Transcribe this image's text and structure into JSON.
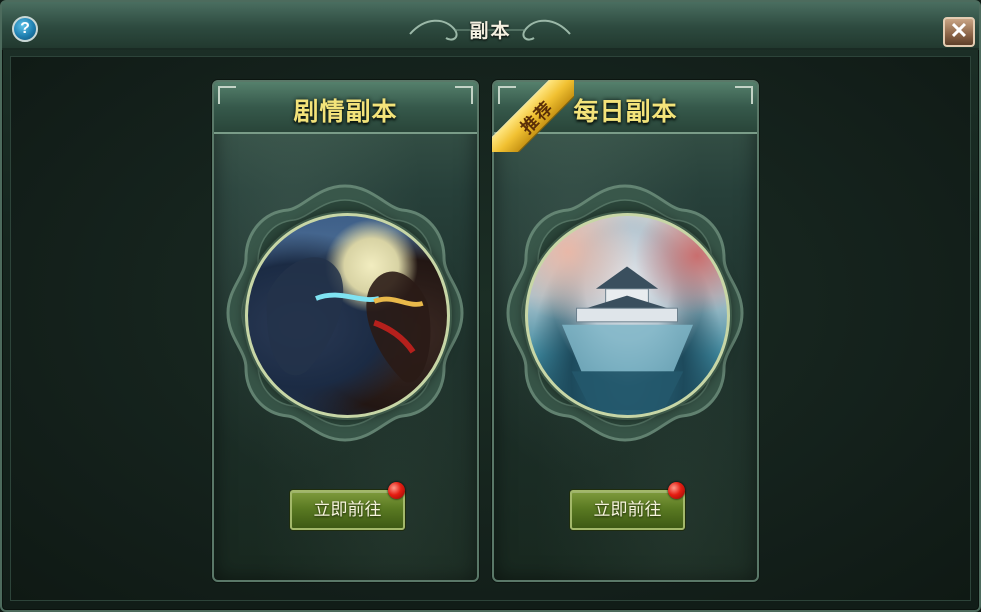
{
  "window": {
    "title": "副本",
    "help_icon": "?",
    "close_icon": "✕"
  },
  "cards": [
    {
      "id": "story",
      "title": "剧情副本",
      "art": "two-warriors-clash-moon",
      "button_label": "立即前往",
      "has_notification": true
    },
    {
      "id": "daily",
      "title": "每日副本",
      "art": "floating-palace-ruins",
      "badge": "推荐",
      "button_label": "立即前往",
      "has_notification": true
    }
  ],
  "colors": {
    "title_gold": "#f3e37a",
    "button_green": "#5a7a22",
    "notification_red": "#e51d12",
    "badge_gold": "#f1c132"
  }
}
